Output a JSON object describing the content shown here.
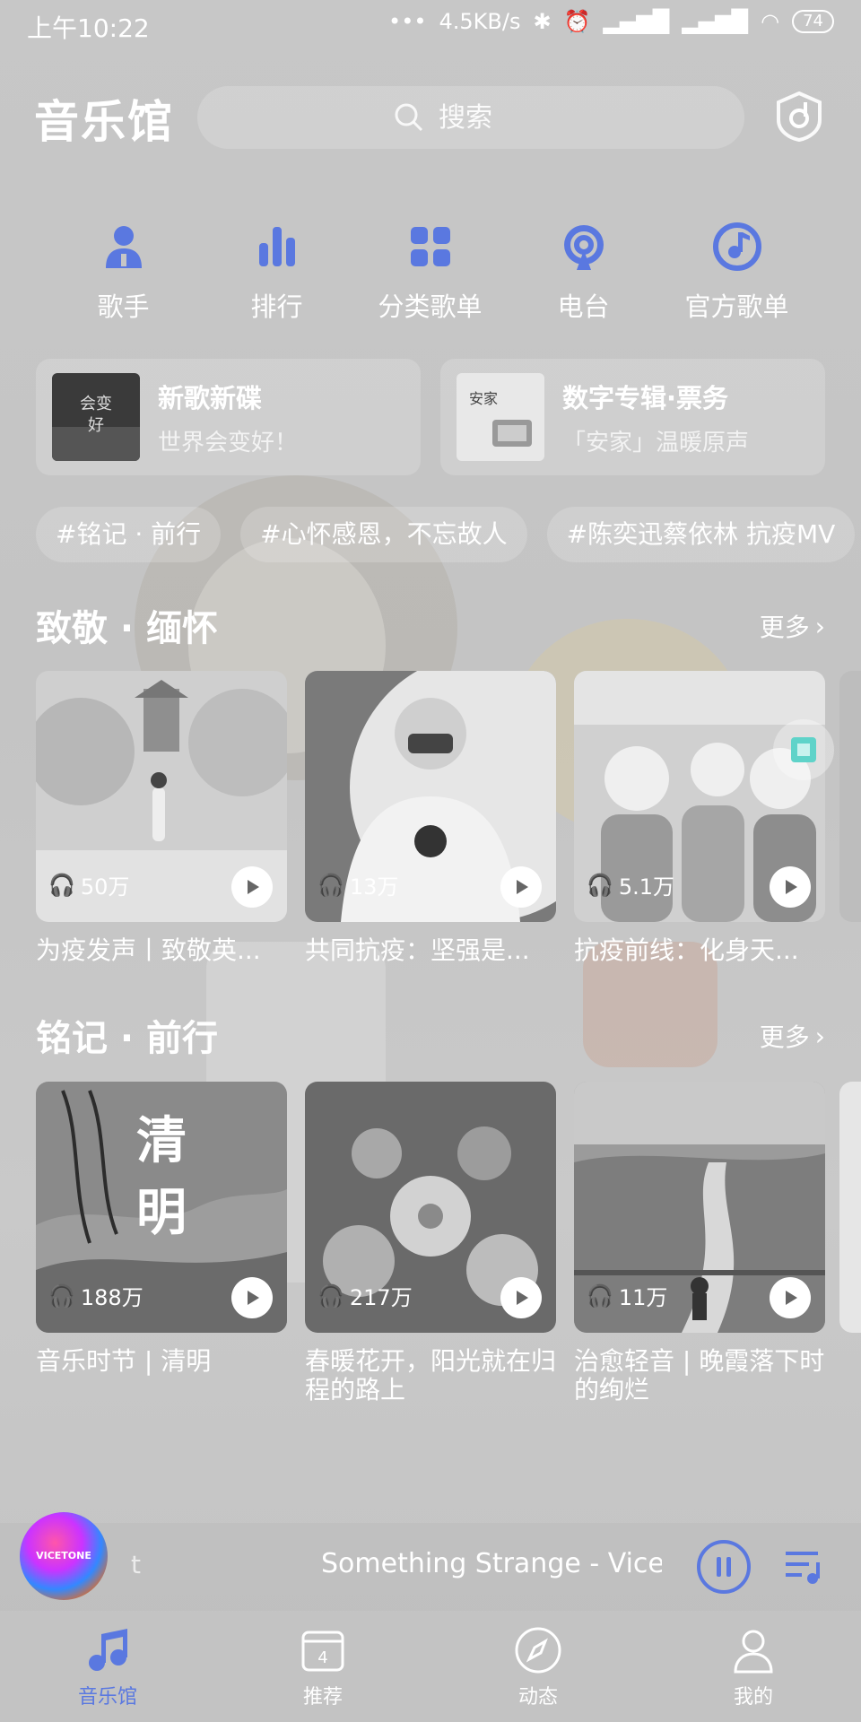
{
  "status_bar": {
    "time": "上午10:22",
    "network_speed": "4.5KB/s",
    "battery": "74"
  },
  "header": {
    "title": "音乐馆",
    "search_placeholder": "搜索"
  },
  "quick_nav": [
    {
      "label": "歌手",
      "icon": "singer-icon"
    },
    {
      "label": "排行",
      "icon": "ranking-icon"
    },
    {
      "label": "分类歌单",
      "icon": "category-icon"
    },
    {
      "label": "电台",
      "icon": "radio-icon"
    },
    {
      "label": "官方歌单",
      "icon": "official-playlist-icon"
    }
  ],
  "promos": [
    {
      "title": "新歌新碟",
      "subtitle": "世界会变好！"
    },
    {
      "title": "数字专辑·票务",
      "subtitle": "「安家」温暖原声"
    }
  ],
  "tags": [
    "#铭记 · 前行",
    "#心怀感恩，不忘故人",
    "#陈奕迅蔡依林 抗疫MV"
  ],
  "sections": [
    {
      "title": "致敬 · 缅怀",
      "more": "更多",
      "cards": [
        {
          "count": "50万",
          "title": "为疫发声丨致敬英..."
        },
        {
          "count": "13万",
          "title": "共同抗疫：坚强是..."
        },
        {
          "count": "5.1万",
          "title": "抗疫前线：化身天..."
        }
      ]
    },
    {
      "title": "铭记 · 前行",
      "more": "更多",
      "cards": [
        {
          "count": "188万",
          "title": "音乐时节 | 清明"
        },
        {
          "count": "217万",
          "title": "春暖花开，阳光就在归程的路上"
        },
        {
          "count": "11万",
          "title": "治愈轻音 | 晚霞落下时的绚烂"
        }
      ]
    }
  ],
  "mini_player": {
    "prev_text": "t",
    "song": "Something Strange - Vicetone"
  },
  "tabs": [
    {
      "label": "音乐馆",
      "icon": "music-note-icon",
      "active": true
    },
    {
      "label": "推荐",
      "icon": "calendar-icon",
      "active": false
    },
    {
      "label": "动态",
      "icon": "compass-icon",
      "active": false
    },
    {
      "label": "我的",
      "icon": "profile-icon",
      "active": false
    }
  ],
  "colors": {
    "accent": "#5a78e0",
    "background": "#c6c6c6"
  }
}
